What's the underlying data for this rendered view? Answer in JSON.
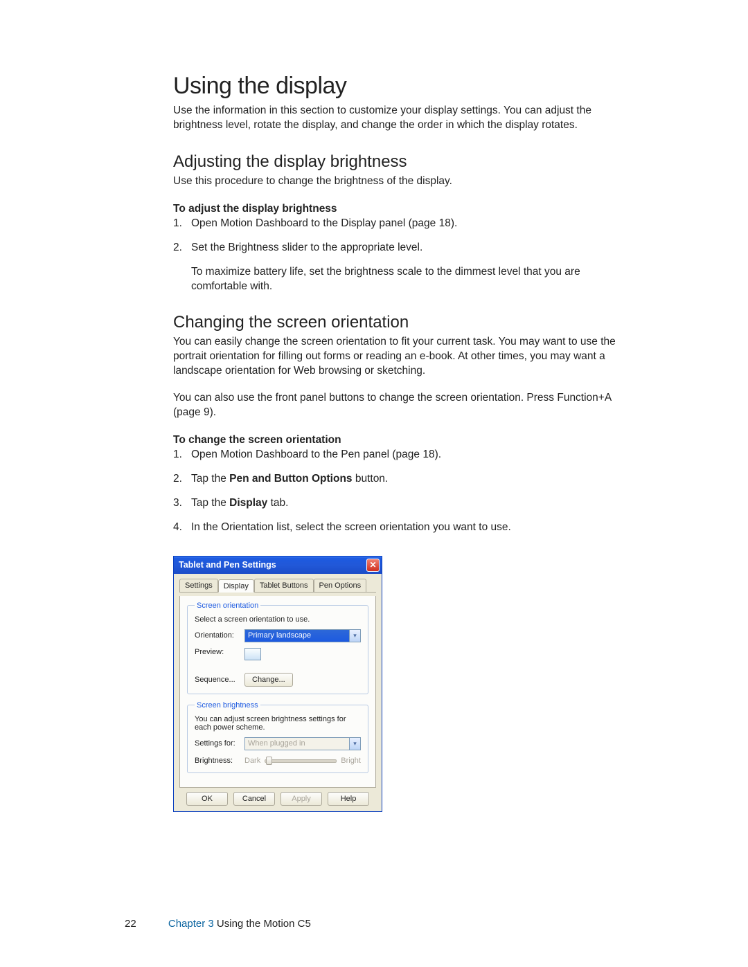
{
  "h1": "Using the display",
  "intro": "Use the information in this section to customize your display settings. You can adjust the brightness level, rotate the display, and change the order in which the display rotates.",
  "sec1": {
    "title": "Adjusting the display brightness",
    "intro": "Use this procedure to change the brightness of the display.",
    "procTitle": "To adjust the display brightness",
    "steps": {
      "s1": "Open Motion Dashboard to the Display panel (page 18).",
      "s2": "Set the Brightness slider to the appropriate level.",
      "s2note": "To maximize battery life, set the brightness scale to the dimmest level that you are comfortable with."
    }
  },
  "sec2": {
    "title": "Changing the screen orientation",
    "p1": "You can easily change the screen orientation to fit your current task. You may want to use the portrait orientation for filling out forms or reading an e-book. At other times, you may want a landscape orientation for Web browsing or sketching.",
    "p2": "You can also use the front panel buttons to change the screen orientation. Press Function+A (page 9).",
    "procTitle": "To change the screen orientation",
    "steps": {
      "s1": "Open Motion Dashboard to the Pen panel (page 18).",
      "s2a": "Tap the ",
      "s2b": "Pen and Button Options",
      "s2c": " button.",
      "s3a": "Tap the ",
      "s3b": "Display",
      "s3c": " tab.",
      "s4": "In the Orientation list, select the screen orientation you want to use."
    }
  },
  "dialog": {
    "title": "Tablet and Pen Settings",
    "tabs": {
      "t1": "Settings",
      "t2": "Display",
      "t3": "Tablet Buttons",
      "t4": "Pen Options"
    },
    "group1": {
      "legend": "Screen orientation",
      "note": "Select a screen orientation to use.",
      "orientationLabel": "Orientation:",
      "orientationValue": "Primary landscape",
      "previewLabel": "Preview:",
      "sequenceLabel": "Sequence...",
      "changeBtn": "Change..."
    },
    "group2": {
      "legend": "Screen brightness",
      "note": "You can adjust screen brightness settings for each power scheme.",
      "settingsForLabel": "Settings for:",
      "settingsForValue": "When plugged in",
      "brightnessLabel": "Brightness:",
      "dark": "Dark",
      "bright": "Bright"
    },
    "buttons": {
      "ok": "OK",
      "cancel": "Cancel",
      "apply": "Apply",
      "help": "Help"
    }
  },
  "footer": {
    "page": "22",
    "chapter": "Chapter 3",
    "title": "  Using the Motion C5"
  }
}
